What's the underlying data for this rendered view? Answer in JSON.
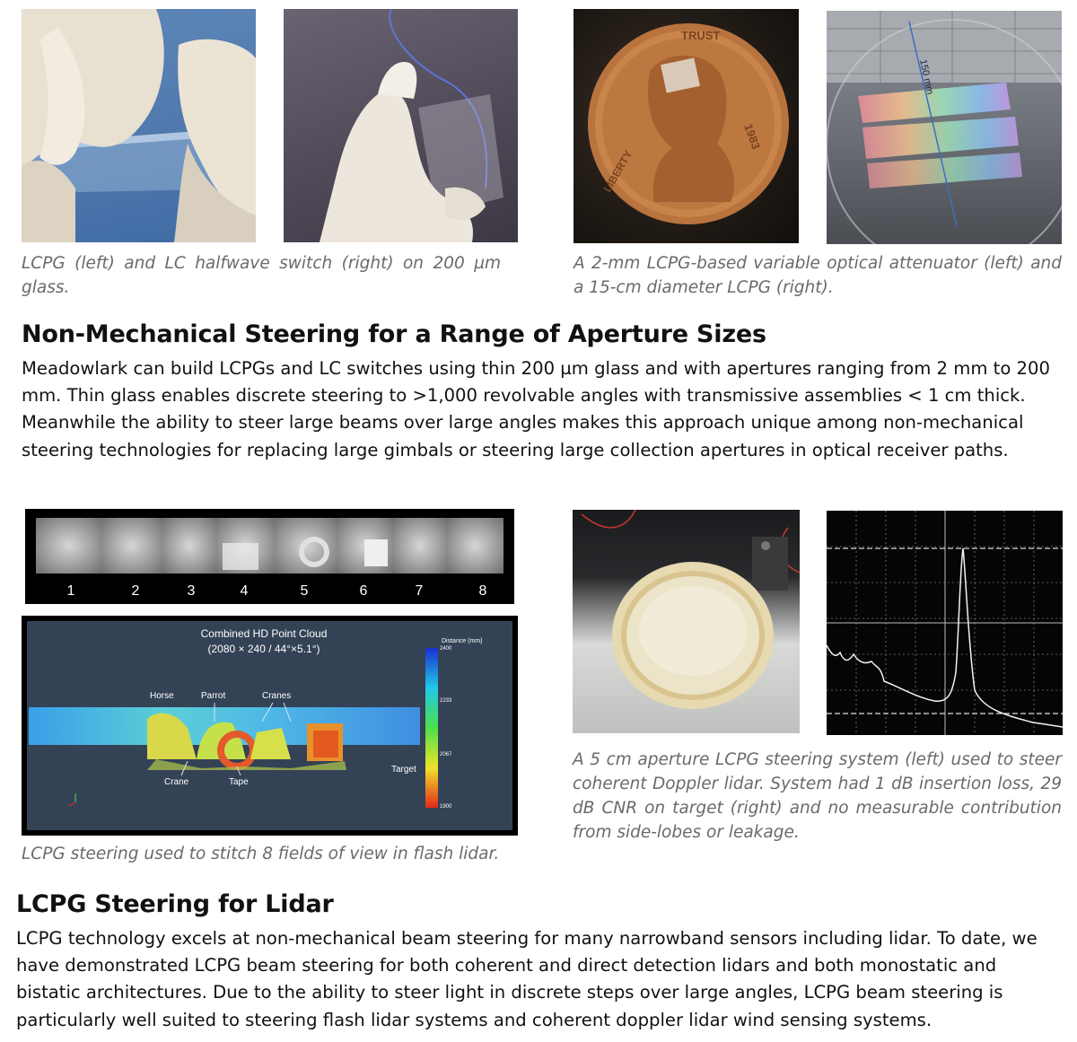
{
  "captions": {
    "top_left": "LCPG (left) and LC halfwave switch (right) on 200 µm glass.",
    "top_right": "A 2-mm LCPG-based variable optical attenuator (left) and a 15-cm diameter LCPG (right).",
    "mid_left": "LCPG steering used to stitch 8 fields of view in flash lidar.",
    "mid_right": "A 5 cm aperture LCPG steering system (left) used to steer coherent Doppler lidar. System had 1 dB insertion loss, 29 dB CNR on target (right) and no measurable contribution from side-lobes or leakage."
  },
  "section1": {
    "heading": "Non-Mechanical Steering for a Range of Aperture Sizes",
    "lines": [
      "Meadowlark can build LCPGs and LC switches using thin 200 µm glass and with apertures ranging from 2 mm to 200",
      "mm. Thin glass enables discrete steering to >1,000 revolvable angles with transmissive assemblies < 1 cm thick.",
      "Meanwhile the ability to steer large beams over large angles makes this approach unique among non-mechanical",
      "steering technologies for replacing large gimbals or steering large collection apertures in optical receiver paths."
    ]
  },
  "section2": {
    "heading": "LCPG Steering for Lidar",
    "lines": [
      "LCPG technology excels at non-mechanical beam steering for many narrowband sensors including lidar. To date, we",
      "have demonstrated LCPG beam steering for both coherent and direct detection lidars and both monostatic and",
      "bistatic architectures. Due to the ability to steer light in discrete steps over large angles, LCPG beam steering is",
      "particularly well suited to steering flash lidar systems and coherent doppler lidar wind sensing systems."
    ]
  },
  "photos": {
    "coin_text_top": "TRUST",
    "coin_text_side": "LIBERTY",
    "coin_year": "1983",
    "scale_label": "150 mm",
    "fov_labels": [
      "1",
      "2",
      "3",
      "4",
      "5",
      "6",
      "7",
      "8"
    ],
    "pointcloud": {
      "title": "Combined HD Point Cloud",
      "subtitle": "(2080 × 240 / 44°×5.1°)",
      "colorbar_title": "Distance (mm)",
      "colorbar_ticks": [
        "2400",
        "2233",
        "2067",
        "1900"
      ],
      "labels": {
        "horse": "Horse",
        "parrot": "Parrot",
        "cranes": "Cranes",
        "crane": "Crane",
        "tape": "Tape",
        "target": "Target"
      }
    }
  },
  "colors": {
    "caption": "#6a6a6a",
    "text": "#111111",
    "pointcloud_bg": "#344256"
  }
}
